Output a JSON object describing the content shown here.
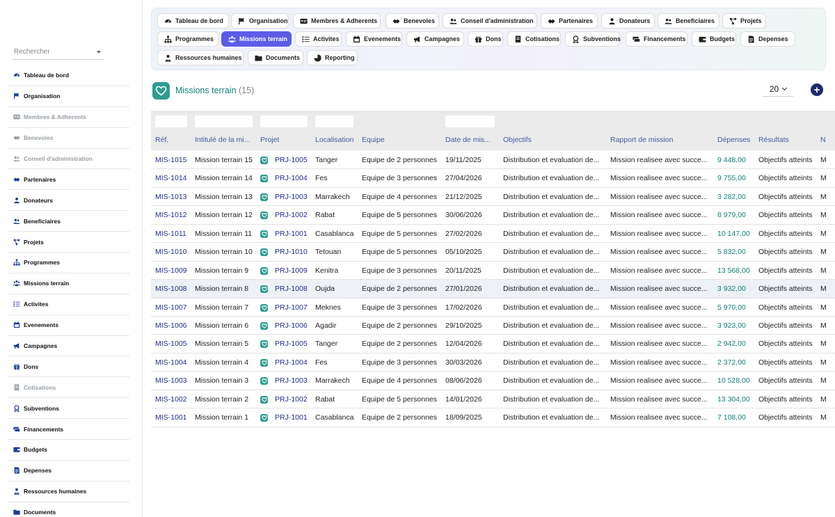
{
  "sidebar": {
    "search_placeholder": "Rechercher",
    "items": [
      {
        "label": "Tableau de bord",
        "icon": "dashboard-icon",
        "disabled": false
      },
      {
        "label": "Organisation",
        "icon": "flag-icon",
        "disabled": false
      },
      {
        "label": "Membres & Adherents",
        "icon": "id-card-icon",
        "disabled": true
      },
      {
        "label": "Benevoles",
        "icon": "handshake-icon",
        "disabled": true
      },
      {
        "label": "Conseil d'administration",
        "icon": "users-icon",
        "disabled": true
      },
      {
        "label": "Partenaires",
        "icon": "handshake-icon",
        "disabled": false
      },
      {
        "label": "Donateurs",
        "icon": "user-icon",
        "disabled": false
      },
      {
        "label": "Beneficiaires",
        "icon": "users-icon",
        "disabled": false
      },
      {
        "label": "Projets",
        "icon": "project-icon",
        "disabled": false
      },
      {
        "label": "Programmes",
        "icon": "sitemap-icon",
        "disabled": false
      },
      {
        "label": "Missions terrain",
        "icon": "people-group-icon",
        "disabled": false
      },
      {
        "label": "Activites",
        "icon": "list-icon",
        "disabled": false
      },
      {
        "label": "Evenements",
        "icon": "calendar-icon",
        "disabled": false
      },
      {
        "label": "Campagnes",
        "icon": "megaphone-icon",
        "disabled": false
      },
      {
        "label": "Dons",
        "icon": "gift-icon",
        "disabled": false
      },
      {
        "label": "Cotisations",
        "icon": "receipt-icon",
        "disabled": true
      },
      {
        "label": "Subventions",
        "icon": "award-icon",
        "disabled": false
      },
      {
        "label": "Financements",
        "icon": "money-icon",
        "disabled": false
      },
      {
        "label": "Budgets",
        "icon": "wallet-icon",
        "disabled": false
      },
      {
        "label": "Depenses",
        "icon": "invoice-icon",
        "disabled": false
      },
      {
        "label": "Ressources humaines",
        "icon": "user-tie-icon",
        "disabled": false
      },
      {
        "label": "Documents",
        "icon": "folder-icon",
        "disabled": false
      }
    ]
  },
  "topnav": {
    "chips": [
      {
        "label": "Tableau de bord",
        "icon": "dashboard-icon"
      },
      {
        "label": "Organisation",
        "icon": "flag-icon"
      },
      {
        "label": "Membres & Adherents",
        "icon": "id-card-icon"
      },
      {
        "label": "Benevoles",
        "icon": "handshake-icon"
      },
      {
        "label": "Conseil d'administration",
        "icon": "users-icon"
      },
      {
        "label": "Partenaires",
        "icon": "handshake-icon"
      },
      {
        "label": "Donateurs",
        "icon": "user-icon"
      },
      {
        "label": "Beneficiaires",
        "icon": "users-icon"
      },
      {
        "label": "Projets",
        "icon": "project-icon"
      },
      {
        "label": "Programmes",
        "icon": "sitemap-icon"
      },
      {
        "label": "Missions terrain",
        "icon": "people-group-icon",
        "active": true
      },
      {
        "label": "Activites",
        "icon": "list-icon"
      },
      {
        "label": "Evenements",
        "icon": "calendar-icon"
      },
      {
        "label": "Campagnes",
        "icon": "megaphone-icon"
      },
      {
        "label": "Dons",
        "icon": "gift-icon"
      },
      {
        "label": "Cotisations",
        "icon": "receipt-icon"
      },
      {
        "label": "Subventions",
        "icon": "award-icon"
      },
      {
        "label": "Financements",
        "icon": "money-icon"
      },
      {
        "label": "Budgets",
        "icon": "wallet-icon"
      },
      {
        "label": "Depenses",
        "icon": "invoice-icon"
      },
      {
        "label": "Ressources humaines",
        "icon": "user-tie-icon"
      },
      {
        "label": "Documents",
        "icon": "folder-icon"
      },
      {
        "label": "Reporting",
        "icon": "chart-icon"
      }
    ]
  },
  "header": {
    "title": "Missions terrain",
    "count": "(15)",
    "page_size": "20",
    "add_label": "+"
  },
  "table": {
    "columns": [
      "Réf.",
      "Intitulé de la mi...",
      "Projet",
      "Localisation",
      "Equipe",
      "Date de mis...",
      "Objectifs",
      "Rapport de mission",
      "Dépenses",
      "Résultats",
      "N"
    ],
    "rows": [
      [
        "MIS-1015",
        "Mission terrain 15",
        "PRJ-1005",
        "Tanger",
        "Equipe de 2 personnes",
        "19/11/2025",
        "Distribution et evaluation de...",
        "Mission realisee avec succe...",
        "9 448,00",
        "Objectifs atteints",
        "M"
      ],
      [
        "MIS-1014",
        "Mission terrain 14",
        "PRJ-1004",
        "Fes",
        "Equipe de 3 personnes",
        "27/04/2026",
        "Distribution et evaluation de...",
        "Mission realisee avec succe...",
        "9 755,00",
        "Objectifs atteints",
        "M"
      ],
      [
        "MIS-1013",
        "Mission terrain 13",
        "PRJ-1003",
        "Marrakech",
        "Equipe de 4 personnes",
        "21/12/2025",
        "Distribution et evaluation de...",
        "Mission realisee avec succe...",
        "3 282,00",
        "Objectifs atteints",
        "M"
      ],
      [
        "MIS-1012",
        "Mission terrain 12",
        "PRJ-1002",
        "Rabat",
        "Equipe de 5 personnes",
        "30/06/2026",
        "Distribution et evaluation de...",
        "Mission realisee avec succe...",
        "8 979,00",
        "Objectifs atteints",
        "M"
      ],
      [
        "MIS-1011",
        "Mission terrain 11",
        "PRJ-1001",
        "Casablanca",
        "Equipe de 5 personnes",
        "27/02/2026",
        "Distribution et evaluation de...",
        "Mission realisee avec succe...",
        "10 147,00",
        "Objectifs atteints",
        "M"
      ],
      [
        "MIS-1010",
        "Mission terrain 10",
        "PRJ-1010",
        "Tetouan",
        "Equipe de 5 personnes",
        "05/10/2025",
        "Distribution et evaluation de...",
        "Mission realisee avec succe...",
        "5 832,00",
        "Objectifs atteints",
        "M"
      ],
      [
        "MIS-1009",
        "Mission terrain 9",
        "PRJ-1009",
        "Kenitra",
        "Equipe de 3 personnes",
        "20/11/2025",
        "Distribution et evaluation de...",
        "Mission realisee avec succe...",
        "13 568,00",
        "Objectifs atteints",
        "M"
      ],
      [
        "MIS-1008",
        "Mission terrain 8",
        "PRJ-1008",
        "Oujda",
        "Equipe de 2 personnes",
        "27/01/2026",
        "Distribution et evaluation de...",
        "Mission realisee avec succe...",
        "3 932,00",
        "Objectifs atteints",
        "M"
      ],
      [
        "MIS-1007",
        "Mission terrain 7",
        "PRJ-1007",
        "Meknes",
        "Equipe de 3 personnes",
        "17/02/2026",
        "Distribution et evaluation de...",
        "Mission realisee avec succe...",
        "5 970,00",
        "Objectifs atteints",
        "M"
      ],
      [
        "MIS-1006",
        "Mission terrain 6",
        "PRJ-1006",
        "Agadir",
        "Equipe de 2 personnes",
        "29/10/2025",
        "Distribution et evaluation de...",
        "Mission realisee avec succe...",
        "3 923,00",
        "Objectifs atteints",
        "M"
      ],
      [
        "MIS-1005",
        "Mission terrain 5",
        "PRJ-1005",
        "Tanger",
        "Equipe de 2 personnes",
        "12/04/2026",
        "Distribution et evaluation de...",
        "Mission realisee avec succe...",
        "2 942,00",
        "Objectifs atteints",
        "M"
      ],
      [
        "MIS-1004",
        "Mission terrain 4",
        "PRJ-1004",
        "Fes",
        "Equipe de 3 personnes",
        "30/03/2026",
        "Distribution et evaluation de...",
        "Mission realisee avec succe...",
        "2 372,00",
        "Objectifs atteints",
        "M"
      ],
      [
        "MIS-1003",
        "Mission terrain 3",
        "PRJ-1003",
        "Marrakech",
        "Equipe de 4 personnes",
        "08/06/2026",
        "Distribution et evaluation de...",
        "Mission realisee avec succe...",
        "10 528,00",
        "Objectifs atteints",
        "M"
      ],
      [
        "MIS-1002",
        "Mission terrain 2",
        "PRJ-1002",
        "Rabat",
        "Equipe de 5 personnes",
        "14/01/2026",
        "Distribution et evaluation de...",
        "Mission realisee avec succe...",
        "13 304,00",
        "Objectifs atteints",
        "M"
      ],
      [
        "MIS-1001",
        "Mission terrain 1",
        "PRJ-1001",
        "Casablanca",
        "Equipe de 2 personnes",
        "18/09/2025",
        "Distribution et evaluation de...",
        "Mission realisee avec succe...",
        "7 108,00",
        "Objectifs atteints",
        "M"
      ]
    ],
    "highlighted_row": 7
  },
  "colors": {
    "accent": "#5b5ce6",
    "link": "#1f2d8f",
    "teal": "#11807a",
    "header_text": "#3f5b9c"
  }
}
